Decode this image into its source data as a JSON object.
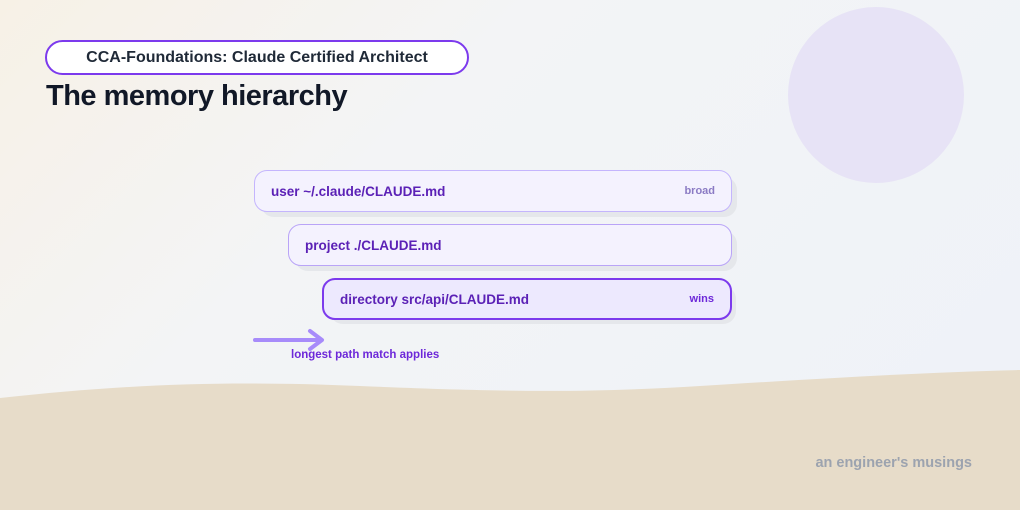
{
  "header": {
    "course_label": "CCA-Foundations: Claude Certified Architect",
    "title": "The memory hierarchy"
  },
  "layers": [
    {
      "label": "user ~/.claude/CLAUDE.md",
      "tag": "broad"
    },
    {
      "label": "project ./CLAUDE.md",
      "tag": ""
    },
    {
      "label": "directory src/api/CLAUDE.md",
      "tag": "wins"
    }
  ],
  "annotation": {
    "arrow_label": "longest path match applies"
  },
  "footer": {
    "brand": "an engineer's musings"
  },
  "colors": {
    "accent": "#7c3aed",
    "text_purple": "#5b21b6",
    "sand": "#e7dcc9",
    "circle": "#e7e3f6"
  }
}
